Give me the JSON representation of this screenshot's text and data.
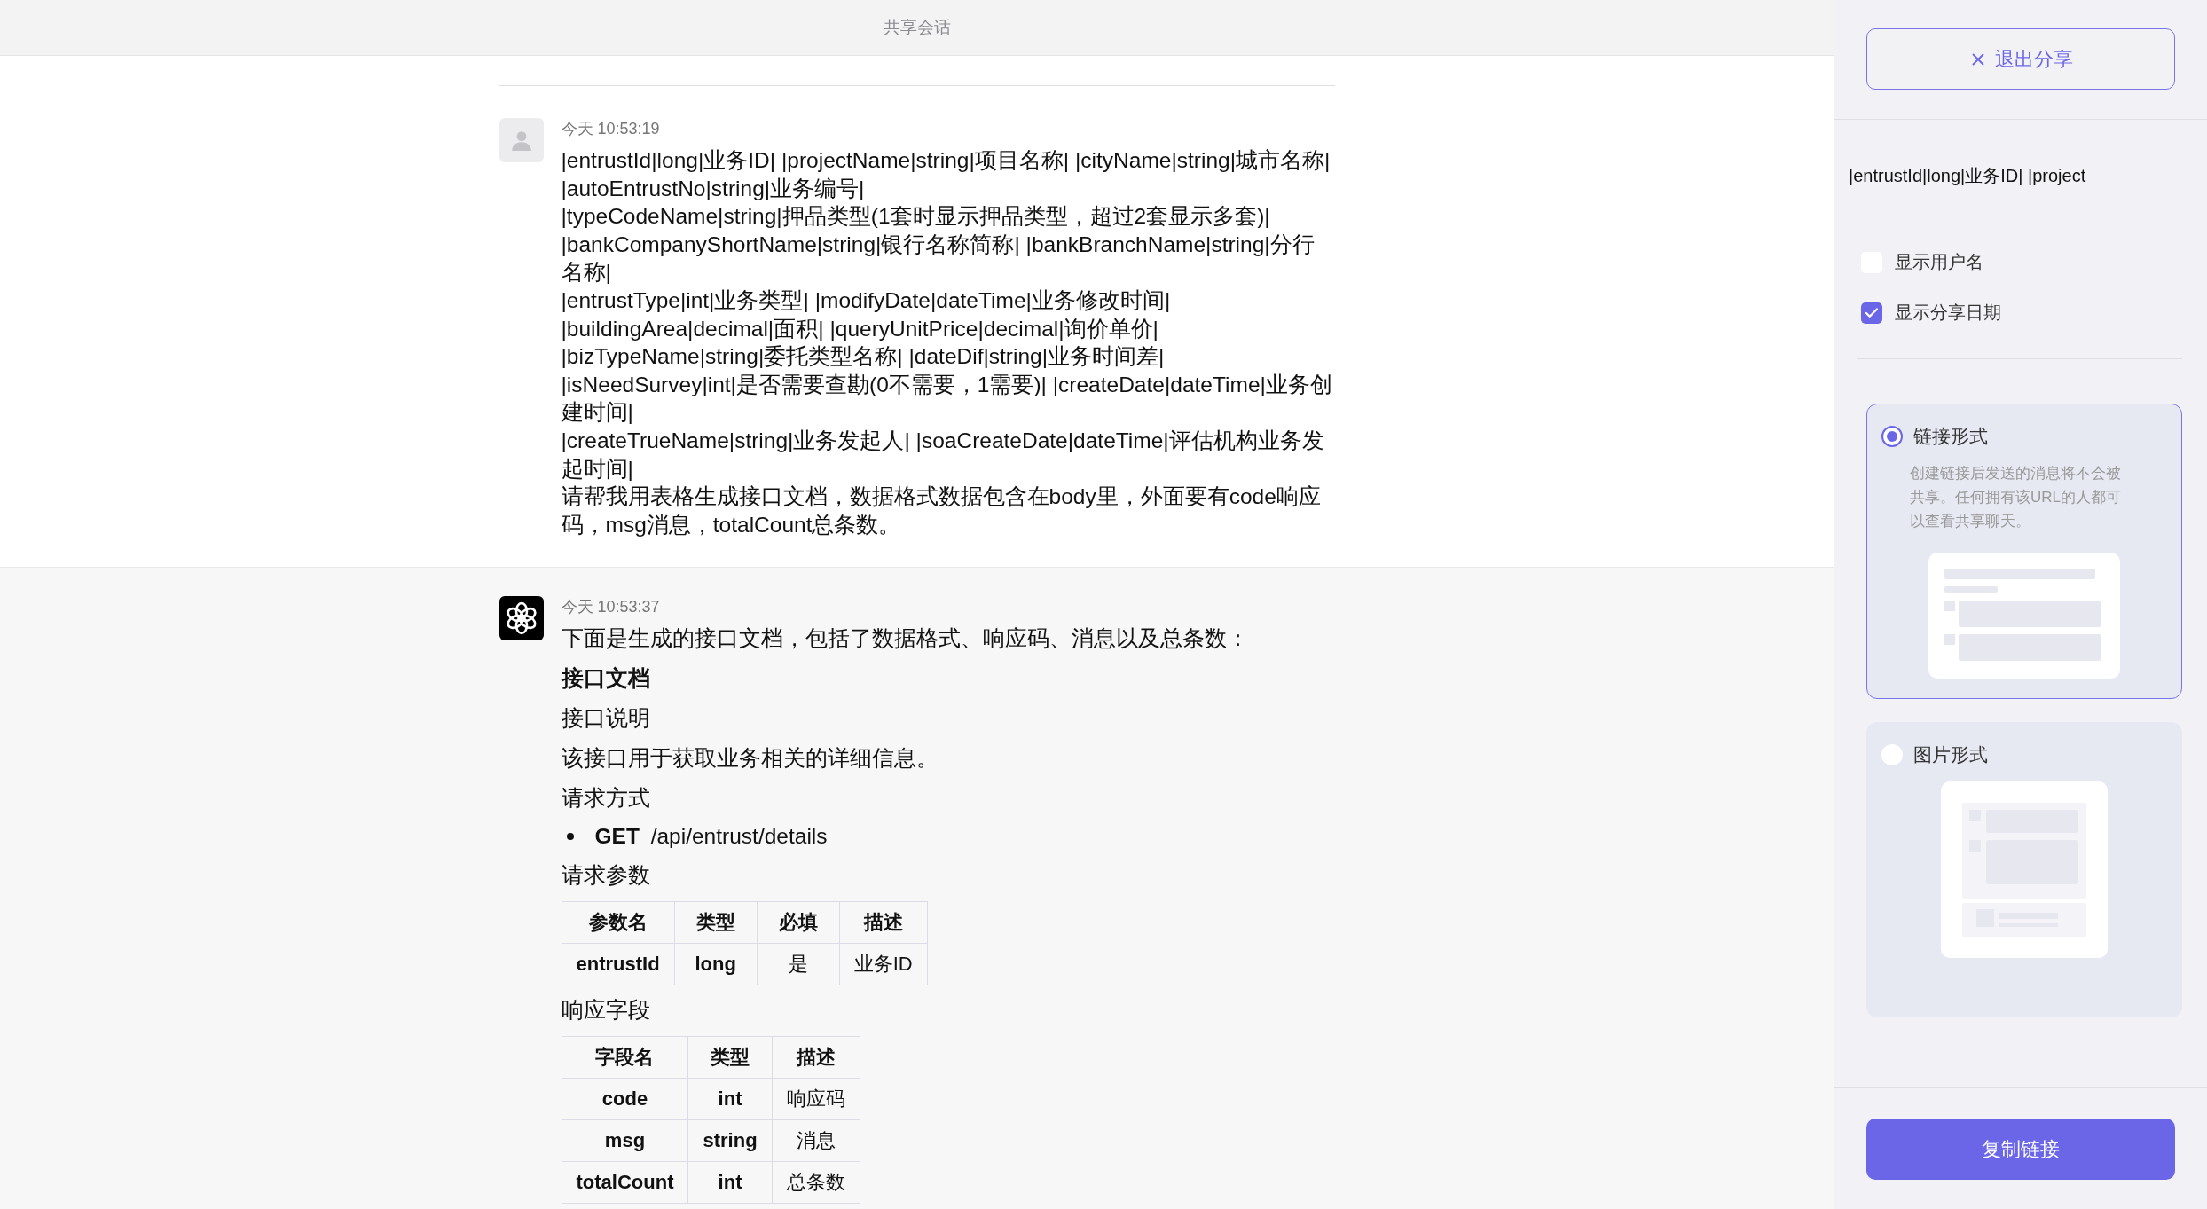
{
  "header": {
    "title": "共享会话"
  },
  "messages": [
    {
      "kind": "user",
      "time": "今天 10:53:19",
      "lines": [
        "|entrustId|long|业务ID| |projectName|string|项目名称| |cityName|string|城市名称|",
        "|autoEntrustNo|string|业务编号|",
        "|typeCodeName|string|押品类型(1套时显示押品类型，超过2套显示多套)|",
        "|bankCompanyShortName|string|银行名称简称| |bankBranchName|string|分行名称|",
        "|entrustType|int|业务类型| |modifyDate|dateTime|业务修改时间|",
        "|buildingArea|decimal|面积| |queryUnitPrice|decimal|询价单价|",
        "|bizTypeName|string|委托类型名称| |dateDif|string|业务时间差|",
        "|isNeedSurvey|int|是否需要查勘(0不需要，1需要)| |createDate|dateTime|业务创建时间|",
        "|createTrueName|string|业务发起人| |soaCreateDate|dateTime|评估机构业务发起时间|",
        "请帮我用表格生成接口文档，数据格式数据包含在body里，外面要有code响应码，msg消息，totalCount总条数。"
      ]
    },
    {
      "kind": "assistant",
      "time": "今天 10:53:37",
      "blocks": [
        {
          "kind": "paragraph",
          "text": "下面是生成的接口文档，包括了数据格式、响应码、消息以及总条数："
        },
        {
          "kind": "heading",
          "text": "接口文档"
        },
        {
          "kind": "paragraph",
          "text": "接口说明"
        },
        {
          "kind": "paragraph",
          "text": "该接口用于获取业务相关的详细信息。"
        },
        {
          "kind": "paragraph",
          "text": "请求方式"
        },
        {
          "kind": "bullet",
          "method": "GET",
          "path": "/api/entrust/details"
        },
        {
          "kind": "paragraph",
          "text": "请求参数"
        },
        {
          "kind": "table",
          "columns": [
            {
              "label": "参数名",
              "bold": true
            },
            {
              "label": "类型",
              "bold": true
            },
            {
              "label": "必填",
              "bold": false
            },
            {
              "label": "描述",
              "bold": false
            }
          ],
          "rows": [
            [
              "entrustId",
              "long",
              "是",
              "业务ID"
            ]
          ]
        },
        {
          "kind": "paragraph",
          "text": "响应字段"
        },
        {
          "kind": "table",
          "columns": [
            {
              "label": "字段名",
              "bold": true
            },
            {
              "label": "类型",
              "bold": true
            },
            {
              "label": "描述",
              "bold": false
            }
          ],
          "rows": [
            [
              "code",
              "int",
              "响应码"
            ],
            [
              "msg",
              "string",
              "消息"
            ],
            [
              "totalCount",
              "int",
              "总条数"
            ]
          ]
        }
      ]
    }
  ],
  "share_panel": {
    "exit_button": "退出分享",
    "preview_text": "|entrustId|long|业务ID| |project",
    "options": [
      {
        "label": "显示用户名",
        "checked": false
      },
      {
        "label": "显示分享日期",
        "checked": true
      }
    ],
    "formats": [
      {
        "kind": "link",
        "label": "链接形式",
        "selected": true,
        "description": "创建链接后发送的消息将不会被共享。任何拥有该URL的人都可以查看共享聊天。"
      },
      {
        "kind": "image",
        "label": "图片形式",
        "selected": false
      }
    ],
    "copy_button": "复制链接"
  }
}
